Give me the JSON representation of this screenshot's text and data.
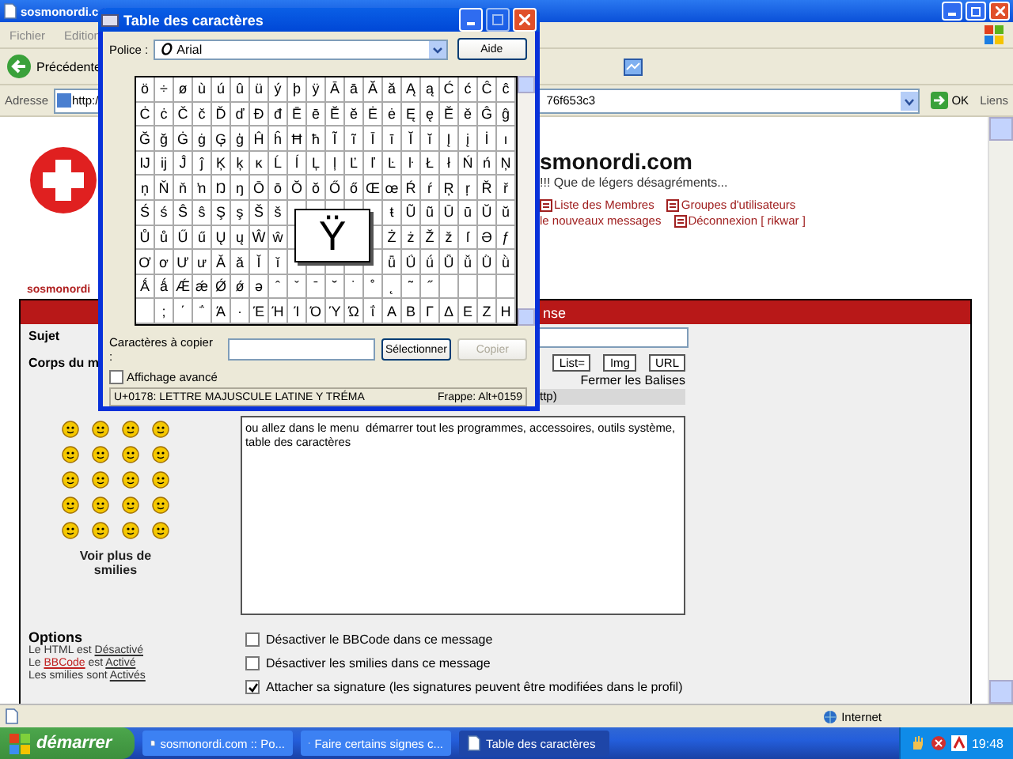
{
  "browser": {
    "title": "sosmonordi.c",
    "menu": [
      "Fichier",
      "Edition"
    ],
    "back_button": "Précédente",
    "address_label": "Adresse",
    "address_start": "http:/",
    "address_end": "76f653c3",
    "go_button": "OK",
    "links_label": "Liens"
  },
  "page": {
    "site_title": "smonordi.com",
    "slogan": "!!! Que de légers désagréments...",
    "nav_rows": [
      [
        {
          "label": "Liste des Membres",
          "icon": true
        },
        {
          "label": "Groupes d'utilisateurs",
          "icon": true
        }
      ],
      [
        {
          "label": "le nouveaux messages",
          "icon": false
        },
        {
          "label": "Déconnexion [ rikwar ]",
          "icon": true
        }
      ]
    ],
    "breadcrumb": "sosmonordi",
    "form": {
      "header": "nse",
      "subject_label": "Sujet",
      "body_label": "Corps du m",
      "tag_buttons": [
        "List=",
        "Img",
        "URL"
      ],
      "close_tags": "Fermer les Balises",
      "hint": "ttp)",
      "message": "ou allez dans le menu  démarrer tout les programmes, accessoires, outils système, table des caractères",
      "smilies_link": "Voir plus de smilies",
      "options_title": "Options",
      "option_lines": [
        [
          {
            "text": "Le HTML est ",
            "kind": "plain"
          },
          {
            "text": "Désactivé",
            "kind": "link"
          }
        ],
        [
          {
            "text": "Le ",
            "kind": "plain"
          },
          {
            "text": "BBCode",
            "kind": "red_link"
          },
          {
            "text": " est ",
            "kind": "plain"
          },
          {
            "text": "Activé",
            "kind": "link"
          }
        ],
        [
          {
            "text": "Les smilies sont ",
            "kind": "plain"
          },
          {
            "text": "Activés",
            "kind": "link"
          }
        ]
      ],
      "checkboxes": [
        {
          "label": "Désactiver le BBCode dans ce message",
          "checked": false
        },
        {
          "label": "Désactiver les smilies dans ce message",
          "checked": false
        },
        {
          "label": "Attacher sa signature (les signatures peuvent être modifiées dans le profil)",
          "checked": true
        }
      ]
    }
  },
  "status_bar": {
    "zone": "Internet"
  },
  "taskbar": {
    "start": "démarrer",
    "tasks": [
      {
        "label": "sosmonordi.com :: Po...",
        "selected": false
      },
      {
        "label": "Faire certains signes c...",
        "selected": false
      },
      {
        "label": "Table des caractères",
        "selected": true
      }
    ],
    "clock": "19:48"
  },
  "dialog": {
    "title": "Table des caractères",
    "font_label": "Police :",
    "font_value": "Arial",
    "help_button": "Aide",
    "grid": [
      {
        "left": [
          "ö",
          "÷",
          "ø",
          "ù",
          "ú",
          "û",
          "ü",
          "ý",
          "þ",
          "ÿ",
          "Ā",
          "ā",
          "Ă",
          "ă",
          "Ą",
          "ą",
          "Ć",
          "ć",
          "Ĉ",
          "ĉ"
        ]
      },
      {
        "left": [
          "Ċ",
          "ċ",
          "Č",
          "č",
          "Ď",
          "ď",
          "Đ",
          "đ",
          "Ē",
          "ē",
          "Ĕ",
          "ĕ",
          "Ė",
          "ė",
          "Ę",
          "ę",
          "Ě",
          "ě",
          "Ĝ",
          "ĝ"
        ]
      },
      {
        "left": [
          "Ğ",
          "ğ",
          "Ġ",
          "ġ",
          "Ģ",
          "ģ",
          "Ĥ",
          "ĥ",
          "Ħ",
          "ħ",
          "Ĩ",
          "ĩ",
          "Ī",
          "ī",
          "Ĭ",
          "ĭ",
          "Į",
          "į",
          "İ",
          "ı"
        ]
      },
      {
        "left": [
          "Ĳ",
          "ĳ",
          "Ĵ",
          "ĵ",
          "Ķ",
          "ķ",
          "ĸ",
          "Ĺ",
          "ĺ",
          "Ļ",
          "ļ",
          "Ľ",
          "ľ",
          "Ŀ",
          "ŀ",
          "Ł",
          "ł",
          "Ń",
          "ń",
          "Ņ"
        ]
      },
      {
        "left": [
          "ņ",
          "Ň",
          "ň",
          "ŉ",
          "Ŋ",
          "ŋ",
          "Ō",
          "ō",
          "Ŏ",
          "ŏ",
          "Ő",
          "ő",
          "Œ",
          "œ",
          "Ŕ",
          "ŕ",
          "Ŗ",
          "ŗ",
          "Ř",
          "ř"
        ]
      },
      {
        "left": [
          "Ś",
          "ś",
          "Ŝ",
          "ŝ",
          "Ş",
          "ş",
          "Š",
          "š"
        ],
        "right": [
          "ŧ",
          "Ũ",
          "ũ",
          "Ū",
          "ū",
          "Ŭ",
          "ŭ"
        ]
      },
      {
        "left": [
          "Ů",
          "ů",
          "Ű",
          "ű",
          "Ų",
          "ų",
          "Ŵ",
          "ŵ"
        ],
        "right": [
          "Ż",
          "ż",
          "Ž",
          "ž",
          "ſ",
          "Ə",
          "ƒ"
        ]
      },
      {
        "left": [
          "Ơ",
          "ơ",
          "Ư",
          "ư",
          "Ǎ",
          "ǎ",
          "Ǐ",
          "ǐ"
        ],
        "right": [
          "ǖ",
          "Ǘ",
          "ǘ",
          "Ǚ",
          "ǚ",
          "Ǜ",
          "ǜ"
        ]
      },
      {
        "left": [
          "Ǻ",
          "ǻ",
          "Ǽ",
          "ǽ",
          "Ǿ",
          "ǿ",
          "ə",
          "ˆ",
          "ˇ",
          "ˉ",
          "˘",
          "˙",
          "˚",
          "˛",
          "˜",
          "˝"
        ]
      },
      {
        "right": [
          ";",
          "΄",
          "΅",
          "Ά",
          "·",
          "Έ",
          "Ή",
          "Ί",
          "Ό",
          "Ύ",
          "Ώ",
          "ΐ",
          "Α",
          "Β",
          "Γ",
          "Δ",
          "Ε",
          "Ζ",
          "Η"
        ]
      }
    ],
    "magnified": "Ÿ",
    "copy_label": "Caractères à copier :",
    "select_button": "Sélectionner",
    "copy_button": {
      "label": "Copier",
      "disabled": true
    },
    "advanced": {
      "label": "Affichage avancé",
      "checked": false
    },
    "status_name": "U+0178: LETTRE MAJUSCULE LATINE Y TRÉMA",
    "status_key": "Frappe: Alt+0159"
  }
}
